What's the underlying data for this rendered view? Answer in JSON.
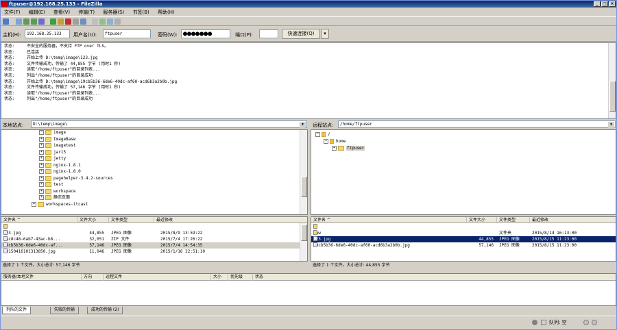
{
  "window": {
    "title": "ftpuser@192.168.25.133 - FileZilla"
  },
  "menu": [
    "文件(F)",
    "编辑(E)",
    "查看(V)",
    "传输(T)",
    "服务器(S)",
    "书签(B)",
    "帮助(H)"
  ],
  "quickconnect": {
    "host_label": "主机(H):",
    "host_value": "192.168.25.133",
    "user_label": "用户名(U):",
    "user_value": "ftpuser",
    "pass_label": "密码(W):",
    "pass_value": "●●●●●●●",
    "port_label": "端口(P):",
    "port_value": "",
    "connect_label": "快速连接(Q)"
  },
  "log": [
    {
      "label": "状态:",
      "text": "不安全的服务器，不支持 FTP over TLS。"
    },
    {
      "label": "状态:",
      "text": "已连接"
    },
    {
      "label": "状态:",
      "text": "开始上传 D:\\temp\\image\\123.jpg"
    },
    {
      "label": "状态:",
      "text": "文件传输成功，传输了 44,855 字节 (用时1 秒)"
    },
    {
      "label": "状态:",
      "text": "读取\"/home/ftpuser\"的目录列表..."
    },
    {
      "label": "状态:",
      "text": "列出\"/home/ftpuser\"的目录成功"
    },
    {
      "label": "状态:",
      "text": "开始上传 D:\\temp\\image\\19cb5b36-6de6-40dc-af60-acd6b3a2b0b.jpg"
    },
    {
      "label": "状态:",
      "text": "文件传输成功，传输了 57,146 字节 (用时1 秒)"
    },
    {
      "label": "状态:",
      "text": "读取\"/home/ftpuser\"的目录列表..."
    },
    {
      "label": "状态:",
      "text": "列出\"/home/ftpuser\"的目录成功"
    }
  ],
  "local": {
    "site_label": "本地站点:",
    "site_path": "D:\\temp\\image\\",
    "tree": [
      {
        "name": "image",
        "expanded": true
      },
      {
        "name": "ImageBase",
        "expanded": false
      },
      {
        "name": "imagetest",
        "expanded": false
      },
      {
        "name": "jar15",
        "expanded": false
      },
      {
        "name": "jetty",
        "expanded": false
      },
      {
        "name": "nginx-1.8.1",
        "expanded": false
      },
      {
        "name": "nginx-1.8.0",
        "expanded": false
      },
      {
        "name": "pagehelper-3.4.2-sources",
        "expanded": false
      },
      {
        "name": "test",
        "expanded": false
      },
      {
        "name": "workspace",
        "expanded": false
      },
      {
        "name": "静态页面",
        "expanded": false
      },
      {
        "name": "workspaces-itcast",
        "expanded": false
      }
    ],
    "columns": [
      "文件名 ^",
      "文件大小",
      "文件类型",
      "最近修改"
    ],
    "files": [
      {
        "name": "..",
        "size": "",
        "type": "",
        "modified": ""
      },
      {
        "name": "123.jpg",
        "size": "44,855",
        "type": "JPEG 图像",
        "modified": "2015/8/9 13:59:22"
      },
      {
        "name": "15c8c48-6ab7-43ac-b8...",
        "size": "32,051",
        "type": "ZIP 文件",
        "modified": "2015/7/4 17:26:22"
      },
      {
        "name": "19cb5b36-6de6-40dc-af...",
        "size": "57,146",
        "type": "JPEG 图像",
        "modified": "2015/7/4 14:54:35"
      },
      {
        "name": "20150416101313850.jpg",
        "size": "11,046",
        "type": "JPEG 图像",
        "modified": "2015/1/16 22:51:10"
      }
    ],
    "status": "选择了 1 个文件。大小总计: 57,146 字节"
  },
  "remote": {
    "site_label": "远程站点:",
    "site_path": "/home/ftpuser",
    "tree": [
      {
        "name": "/",
        "level": 0
      },
      {
        "name": "home",
        "level": 1
      },
      {
        "name": "ftpuser",
        "level": 2
      }
    ],
    "columns": [
      "文件名 ^",
      "文件大小",
      "文件类型",
      "最近修改"
    ],
    "files": [
      {
        "name": "..",
        "size": "",
        "type": "",
        "modified": ""
      },
      {
        "name": "www",
        "size": "",
        "type": "文件夹",
        "modified": "2015/8/14 16:13:00"
      },
      {
        "name": "123.jpg",
        "size": "44,855",
        "type": "JPEG 图像",
        "modified": "2015/8/15 11:23:00"
      },
      {
        "name": "19cb5b36-6de6-40dc-af60-acd6b3a2b0b.jpg",
        "size": "57,146",
        "type": "JPEG 图像",
        "modified": "2015/8/15 11:23:00"
      }
    ],
    "status": "选择了 1 个文件。大小总计: 44,855 字节"
  },
  "queue": {
    "columns": [
      "服务器/本地文件",
      "方向",
      "远程文件",
      "大小",
      "优先级",
      "状态"
    ]
  },
  "tabs": [
    "列队的文件",
    "失败的传输",
    "成功的传输 (2)"
  ],
  "footer": {
    "queue_label": "队列: 空"
  }
}
